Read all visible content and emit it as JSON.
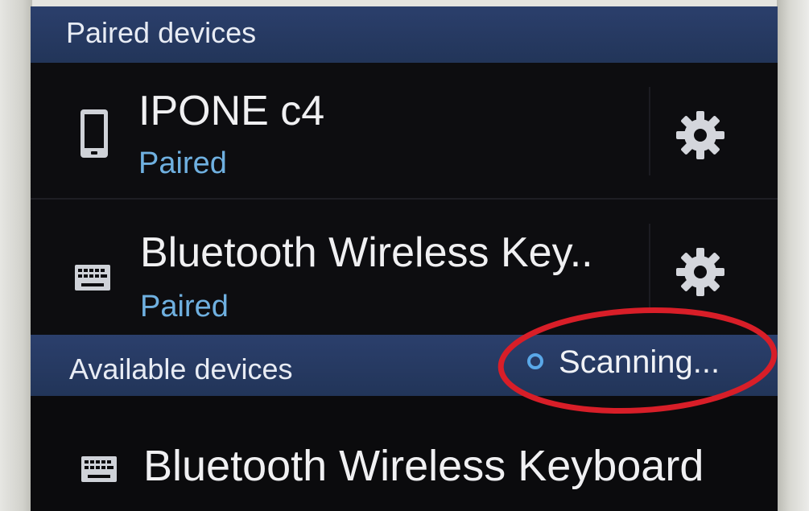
{
  "sections": {
    "paired_label": "Paired devices",
    "available_label": "Available devices"
  },
  "paired_devices": [
    {
      "name": "IPONE  c4",
      "status": "Paired",
      "icon": "phone-icon"
    },
    {
      "name": "Bluetooth Wireless Key..",
      "status": "Paired",
      "icon": "keyboard-icon"
    }
  ],
  "available_devices": [
    {
      "name": "Bluetooth Wireless Keyboard",
      "icon": "keyboard-icon"
    }
  ],
  "scan": {
    "label": "Scanning..."
  },
  "colors": {
    "header_bg": "#26395f",
    "screen_bg": "#0b0b0d",
    "status_text": "#6fb0e0",
    "highlight": "#d81e28"
  }
}
